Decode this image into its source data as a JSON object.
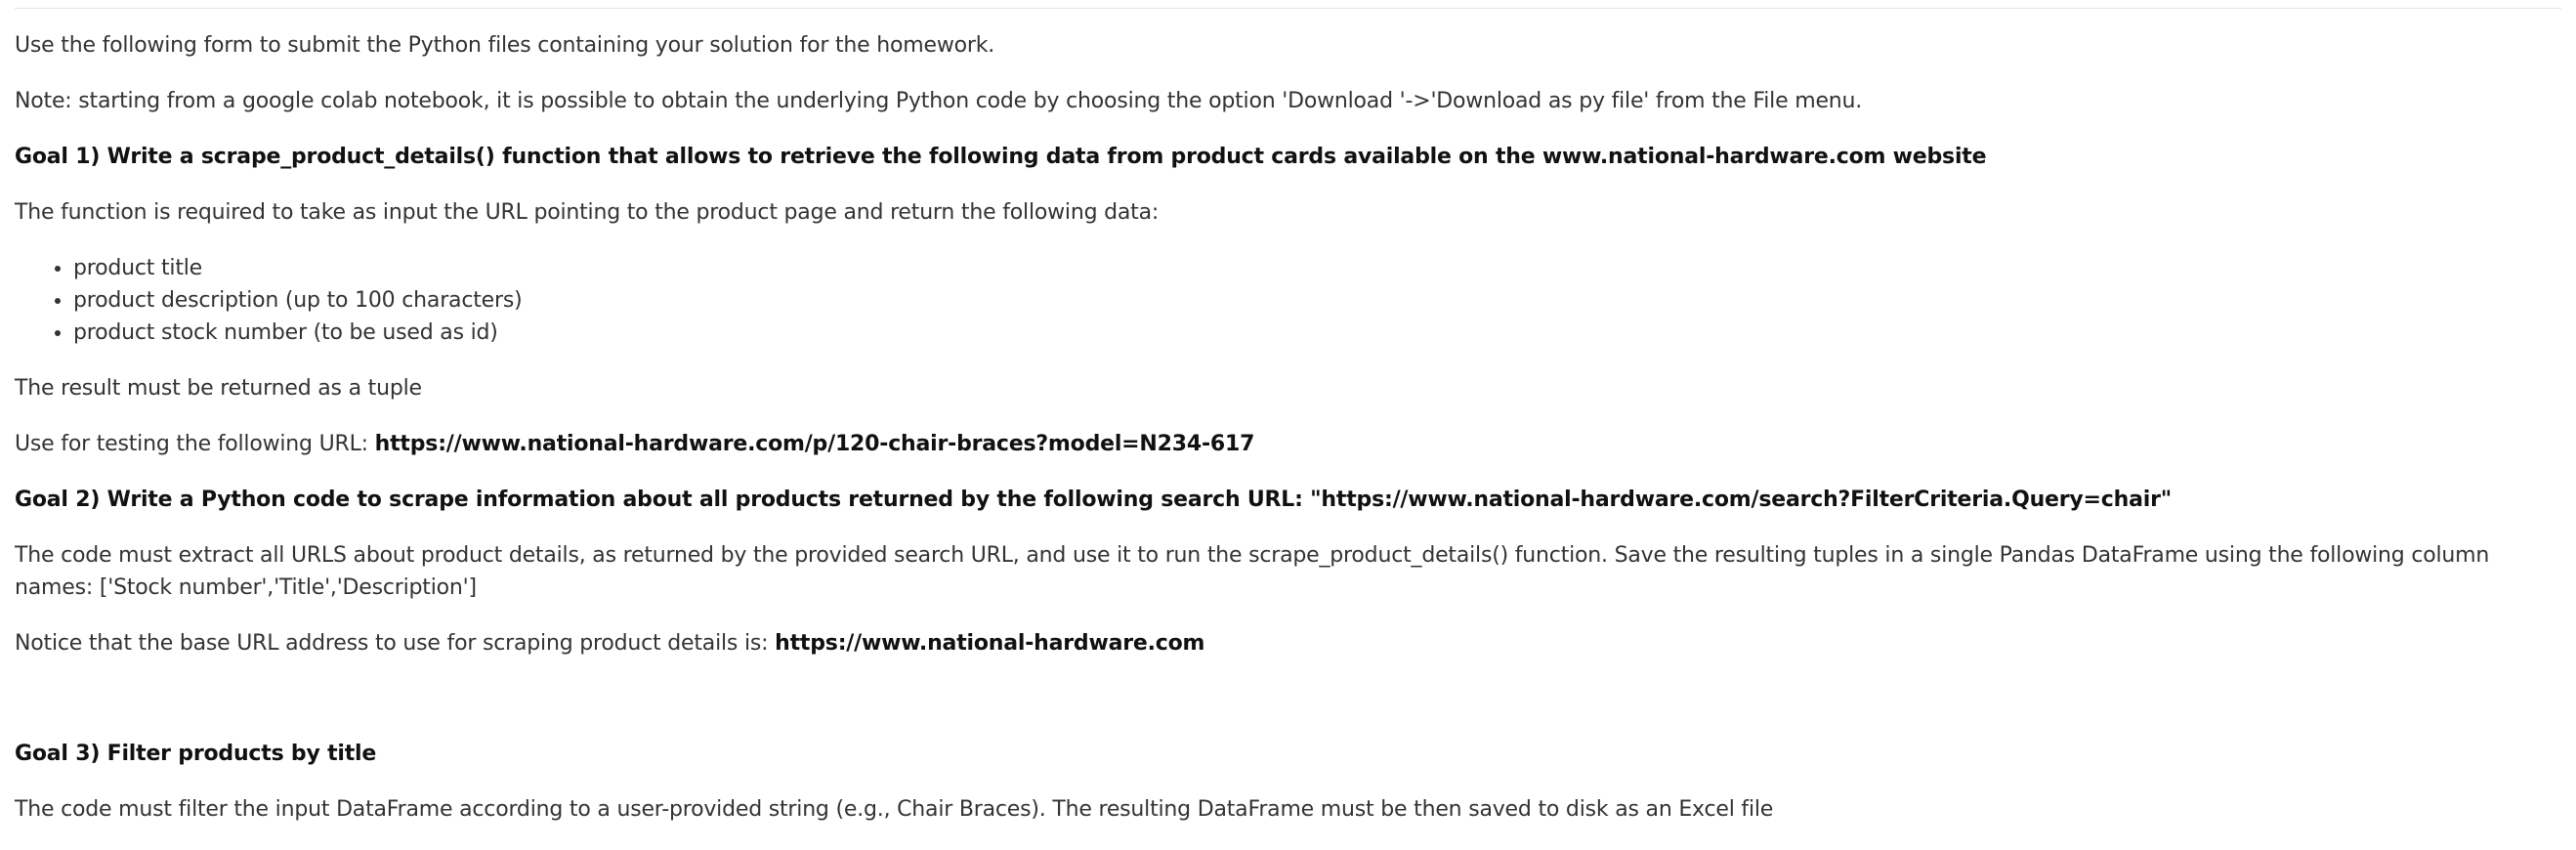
{
  "intro": "Use the following form to submit the Python files  containing your solution for the homework.",
  "note": "Note: starting from a google colab notebook, it is possible to obtain the underlying Python code by choosing the option 'Download '->'Download as py file' from the File menu.",
  "goal1": {
    "title": "Goal 1) Write a scrape_product_details() function that allows to retrieve the following data from product cards available on the www.national-hardware.com website",
    "input_text": "The function is required to take as input the URL pointing to the product page and return the following data:",
    "items": [
      "product title",
      "product description (up to 100 characters)",
      "product stock number (to be used as id)"
    ],
    "result_text": "The result must be returned as a tuple",
    "testing_prefix": "Use for testing the following URL: ",
    "testing_url": "https://www.national-hardware.com/p/120-chair-braces?model=N234-617"
  },
  "goal2": {
    "title": "Goal 2) Write a Python code to scrape information about all products returned by the following search URL: \"https://www.national-hardware.com/search?FilterCriteria.Query=chair\"",
    "description": "The code must extract all URLS about product details, as returned by the provided search URL, and use it to run the scrape_product_details() function. Save the resulting tuples in a single Pandas DataFrame using the following column names: ['Stock number','Title','Description']",
    "base_prefix": "Notice that the base URL address to use for scraping product details is: ",
    "base_url": "https://www.national-hardware.com"
  },
  "goal3": {
    "title": "Goal 3) Filter products by title",
    "description": "The code must filter the input DataFrame according to a user-provided string (e.g., Chair Braces). The resulting DataFrame must be then saved to disk as an Excel file"
  }
}
